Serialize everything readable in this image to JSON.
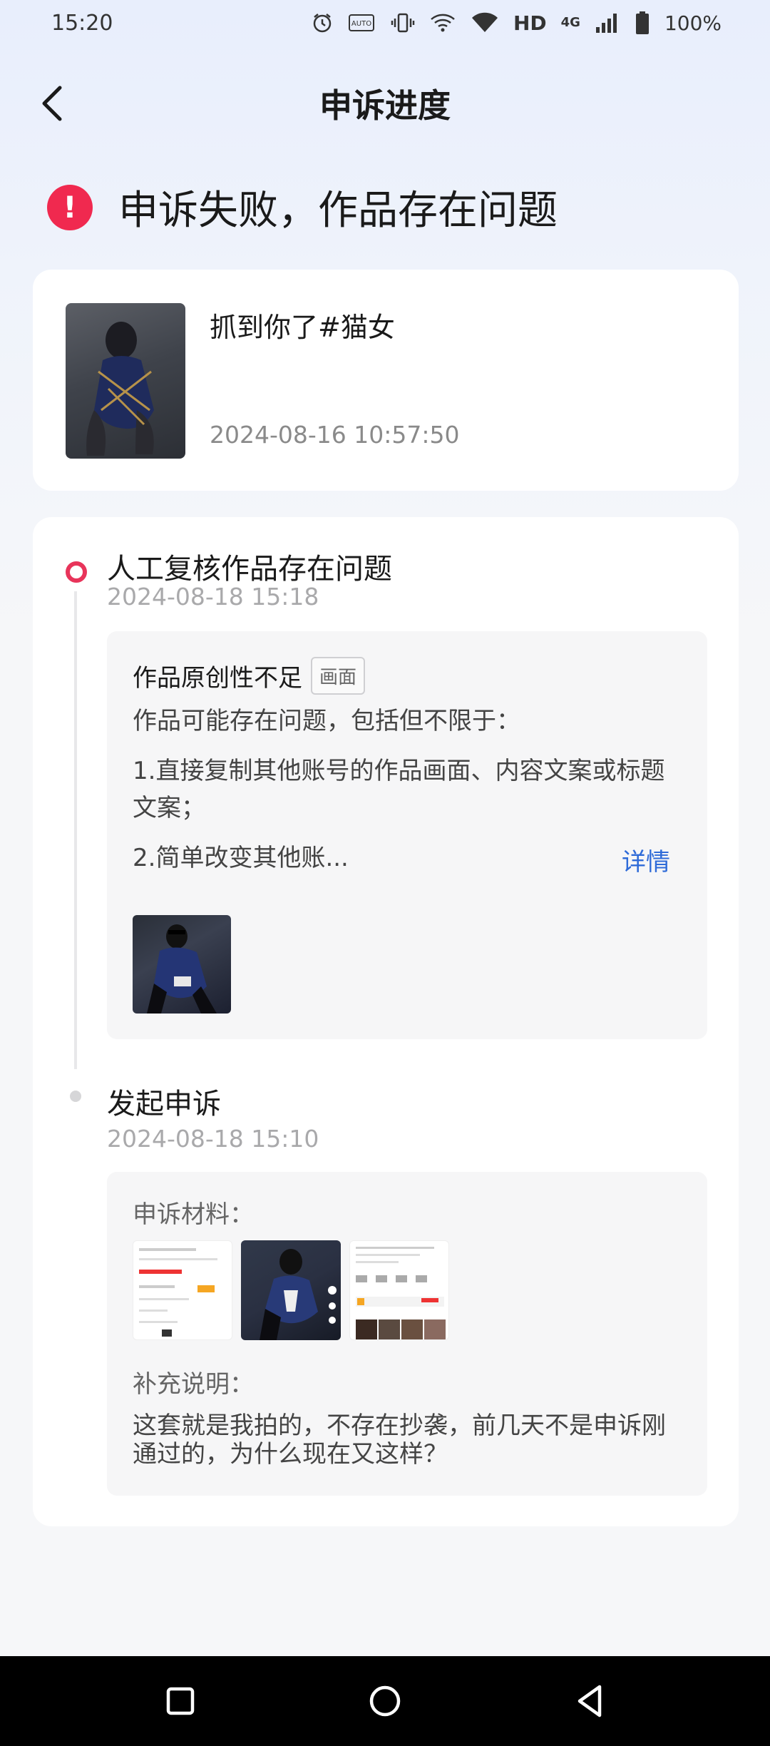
{
  "status_bar": {
    "time": "15:20",
    "icons": [
      "alarm-icon",
      "auto-brightness-icon",
      "vibrate-icon",
      "wifi-call-icon",
      "wifi-icon",
      "hd-icon",
      "4g-icon",
      "signal-icon",
      "battery-icon"
    ],
    "hd_label": "HD",
    "network_label": "4G",
    "auto_label": "AUTO",
    "battery_percent": "100%"
  },
  "nav": {
    "title": "申诉进度",
    "back_icon": "back-arrow-icon"
  },
  "result": {
    "title": "申诉失败，作品存在问题",
    "icon": "error-icon",
    "icon_glyph": "!",
    "color": "#f0294f"
  },
  "work": {
    "title": "抓到你了#猫女",
    "date": "2024-08-16 10:57:50"
  },
  "timeline": {
    "review_step": {
      "title": "人工复核作品存在问题",
      "date": "2024-08-18 15:18",
      "reason_title": "作品原创性不足",
      "reason_tag": "画面",
      "intro": "作品可能存在问题，包括但不限于：",
      "item1": "1.直接复制其他账号的作品画面、内容文案或标题文案；",
      "item2": "2.简单改变其他账...",
      "detail_label": "详情"
    },
    "appeal_step": {
      "title": "发起申诉",
      "date": "2024-08-18 15:10",
      "materials_label": "申诉材料：",
      "note_label": "补充说明：",
      "note_text": "这套就是我拍的，不存在抄袭，前几天不是申诉刚通过的，为什么现在又这样？"
    }
  },
  "colors": {
    "active_dot": "#e8345a",
    "link": "#2f6bd8"
  }
}
